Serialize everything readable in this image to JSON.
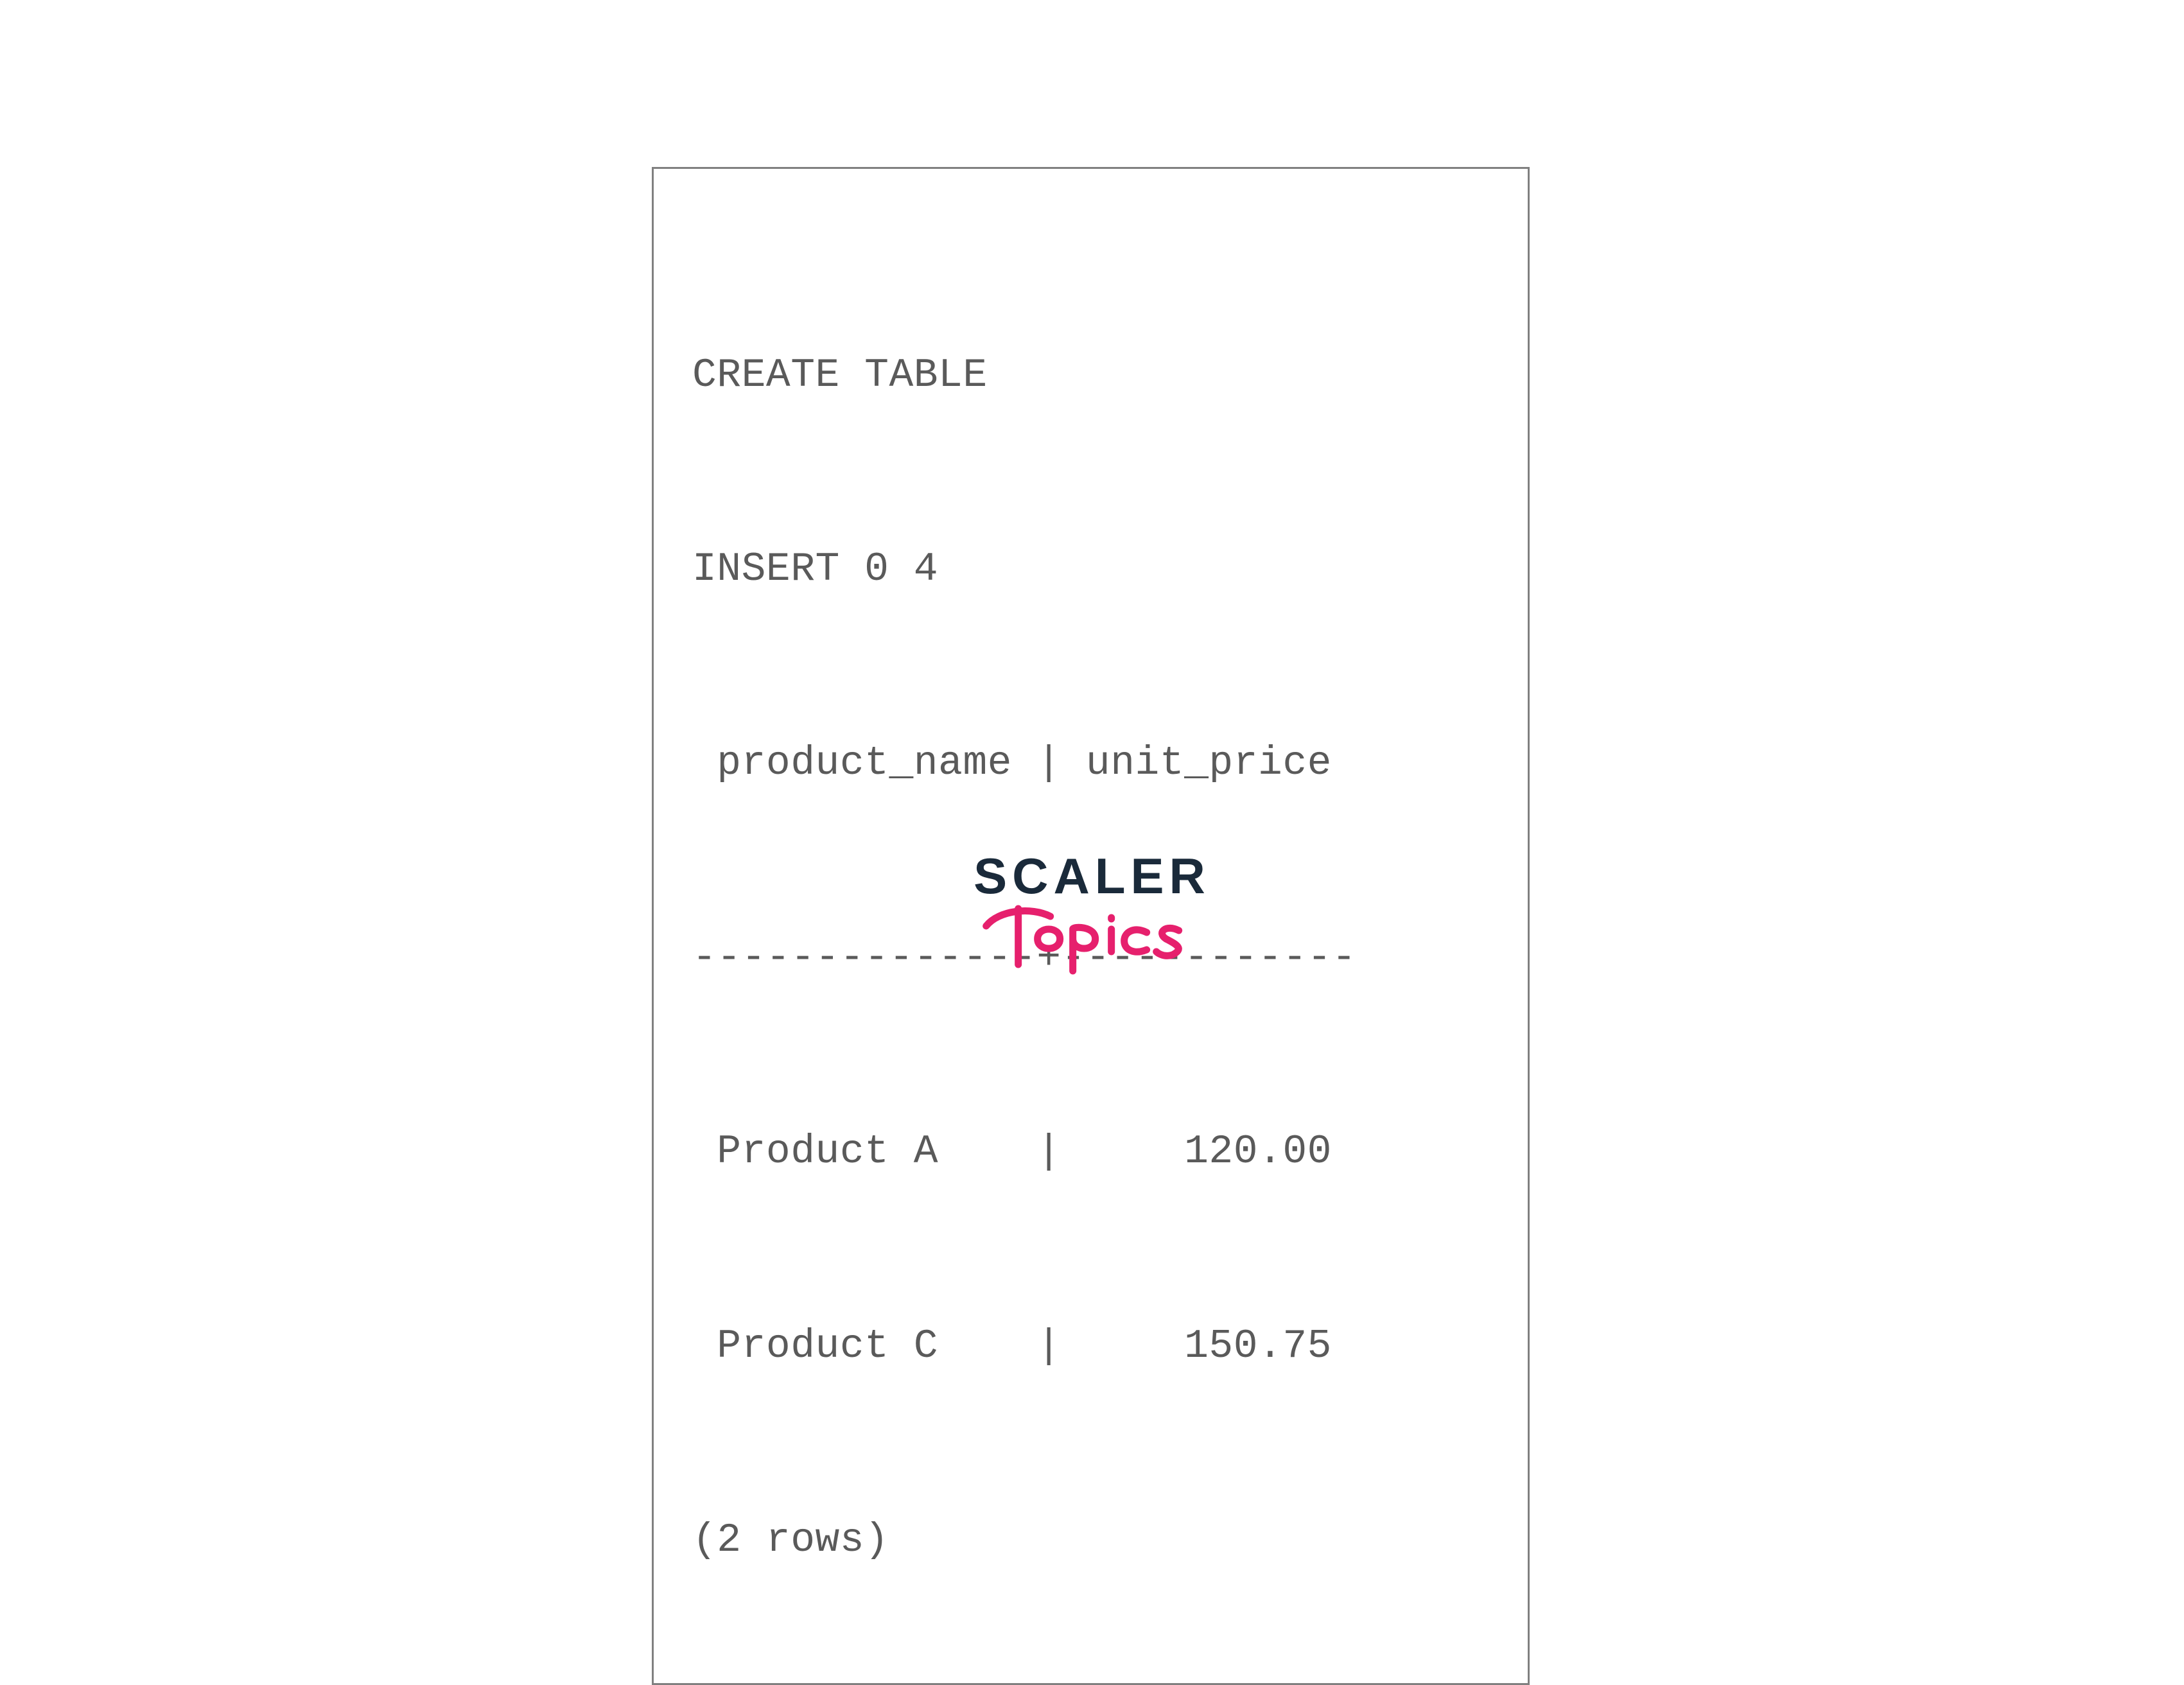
{
  "terminal": {
    "lines": [
      "CREATE TABLE",
      "INSERT 0 4",
      " product_name | unit_price ",
      "--------------+------------",
      " Product A    |     120.00",
      " Product C    |     150.75",
      "(2 rows)"
    ]
  },
  "logo": {
    "top": "SCALER",
    "bottom": "Topics"
  }
}
